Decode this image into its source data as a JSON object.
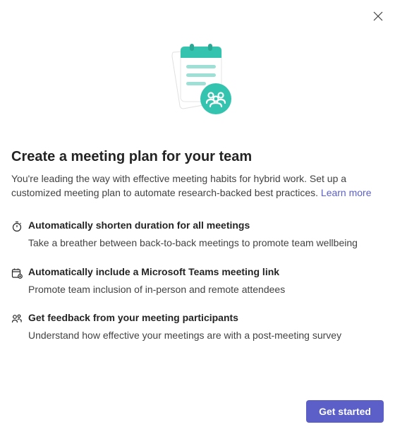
{
  "dialog": {
    "title": "Create a meeting plan for your team",
    "subtitle_prefix": "You're leading the way with effective meeting habits for hybrid work. Set up a customized meeting plan to automate research-backed best practices. ",
    "learn_more_label": "Learn more",
    "features": [
      {
        "title": "Automatically shorten duration for all meetings",
        "desc": "Take a breather between back-to-back meetings to promote team wellbeing"
      },
      {
        "title": "Automatically include a Microsoft Teams meeting link",
        "desc": "Promote team inclusion of in-person and remote attendees"
      },
      {
        "title": "Get feedback from your meeting participants",
        "desc": "Understand how effective your meetings are with a post-meeting survey"
      }
    ],
    "cta_label": "Get started"
  },
  "colors": {
    "accent_teal": "#34C3AE",
    "primary_purple": "#5B5FC7"
  }
}
